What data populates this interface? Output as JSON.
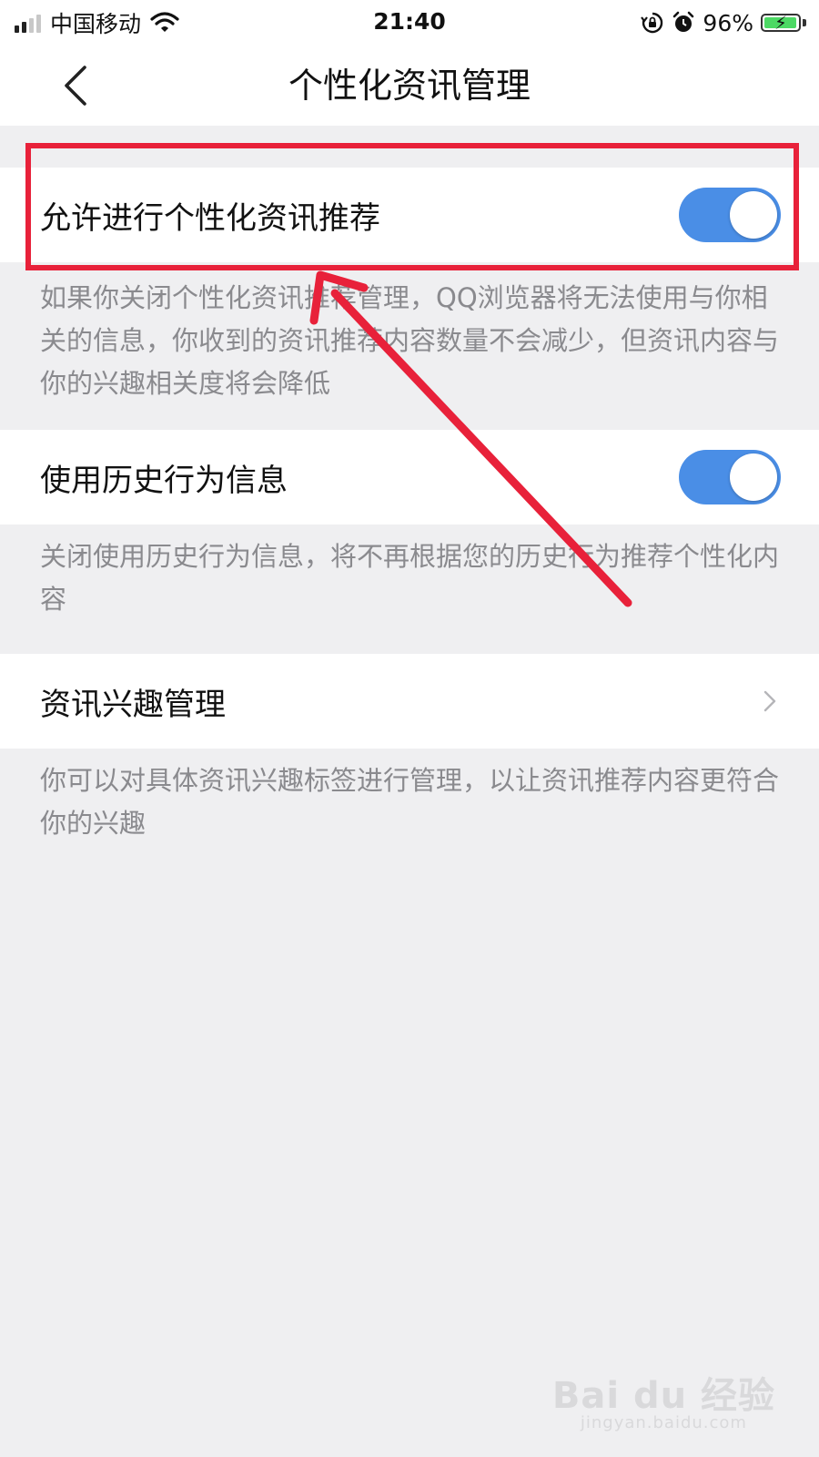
{
  "status_bar": {
    "carrier": "中国移动",
    "time": "21:40",
    "battery_percent": "96%",
    "battery_level": 0.96,
    "signal_bars": 2
  },
  "nav": {
    "title": "个性化资讯管理",
    "back_icon": "chevron-left-icon"
  },
  "settings": [
    {
      "label": "允许进行个性化资讯推荐",
      "control": "toggle",
      "enabled": true,
      "description": "如果你关闭个性化资讯推荐管理，QQ浏览器将无法使用与你相关的信息，你收到的资讯推荐内容数量不会减少，但资讯内容与你的兴趣相关度将会降低"
    },
    {
      "label": "使用历史行为信息",
      "control": "toggle",
      "enabled": true,
      "description": "关闭使用历史行为信息，将不再根据您的历史行为推荐个性化内容"
    },
    {
      "label": "资讯兴趣管理",
      "control": "chevron",
      "description": "你可以对具体资讯兴趣标签进行管理，以让资讯推荐内容更符合你的兴趣"
    }
  ],
  "watermark": {
    "logo": "Bai du 经验",
    "site": "jingyan.baidu.com"
  },
  "colors": {
    "toggle_on": "#4a8ee6",
    "annotation": "#e8213a",
    "background": "#efeff1"
  }
}
